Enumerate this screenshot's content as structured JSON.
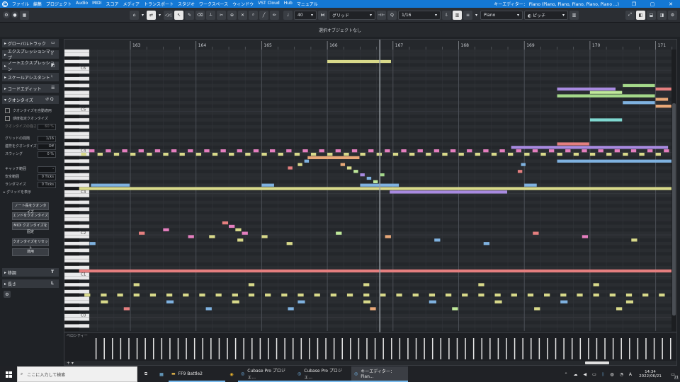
{
  "menubar": {
    "items": [
      "ファイル",
      "編集",
      "プロジェクト",
      "Audio",
      "MIDI",
      "スコア",
      "メディア",
      "トランスポート",
      "スタジオ",
      "ワークスペース",
      "ウィンドウ",
      "VST Cloud",
      "Hub",
      "マニュアル"
    ],
    "window_title": "キーエディター： Piano (Piano, Piano, Piano, Piano, Piano ...)"
  },
  "toolbar": {
    "velocity_value": "40",
    "snap_type": "グリッド",
    "quantize_value": "1/16",
    "instrument": "Piano",
    "expression": "ピッチ"
  },
  "subbar": {
    "status": "選択オブジェクトなし"
  },
  "inspector": {
    "sections": [
      "グローバルトラック",
      "エクスプレッションマップ",
      "ノートエクスプレッション",
      "スケールアシスタント",
      "コードエディット"
    ],
    "quantize": {
      "header": "クオンタイズ",
      "auto_label": "クオンタイズを自動適用",
      "iterative_label": "感度指定クオンタイズ",
      "strength_label": "クオンタイズの強さ",
      "strength_value": "60 %",
      "grid_label": "グリッドの間隔",
      "grid_value": "1/16",
      "triplet_label": "連符をクオンタイズ",
      "triplet_value": "Off",
      "swing_label": "スウィング",
      "swing_value": "0 %",
      "catch_label": "キャッチ範囲",
      "catch_value": "-",
      "safe_label": "安全範囲",
      "safe_value": "0 Ticks",
      "random_label": "ランダマイズ",
      "random_value": "0 Ticks",
      "grid_show_label": "グリッドを表示",
      "btn_length": "ノート長をクオンタイズ",
      "btn_ends": "エンドをクオンタイズ",
      "btn_midi": "MIDI クオンタイズを固定",
      "btn_reset": "クオンタイズをリセット",
      "btn_apply": "適用"
    },
    "transpose_label": "移調",
    "length_label": "長さ"
  },
  "editor": {
    "velocity_lane_label": "ベロシティー",
    "bars": [
      {
        "num": "163",
        "pos": 0.0
      },
      {
        "num": "164",
        "pos": 1.0
      },
      {
        "num": "165",
        "pos": 2.0
      },
      {
        "num": "166",
        "pos": 3.0
      },
      {
        "num": "167",
        "pos": 4.0
      },
      {
        "num": "168",
        "pos": 5.0
      },
      {
        "num": "169",
        "pos": 6.0
      },
      {
        "num": "170",
        "pos": 7.0
      },
      {
        "num": "171",
        "pos": 8.0
      }
    ],
    "octaves": [
      {
        "label": "C6",
        "pitch": 84
      },
      {
        "label": "C5",
        "pitch": 72
      },
      {
        "label": "C4",
        "pitch": 60
      },
      {
        "label": "C3",
        "pitch": 48
      },
      {
        "label": "C2",
        "pitch": 36
      },
      {
        "label": "C1",
        "pitch": 24
      },
      {
        "label": "C0",
        "pitch": 12
      }
    ],
    "playhead_bar": 3.8
  },
  "taskbar": {
    "search_placeholder": "ここに入力して検索",
    "apps": [
      "FF9 Battle2",
      "Cubase Pro プロジェ...",
      "Cubase Pro プロジェ...",
      "キーエディター： Pian..."
    ],
    "time": "14:34",
    "date": "2022/06/21",
    "badge": "21"
  }
}
